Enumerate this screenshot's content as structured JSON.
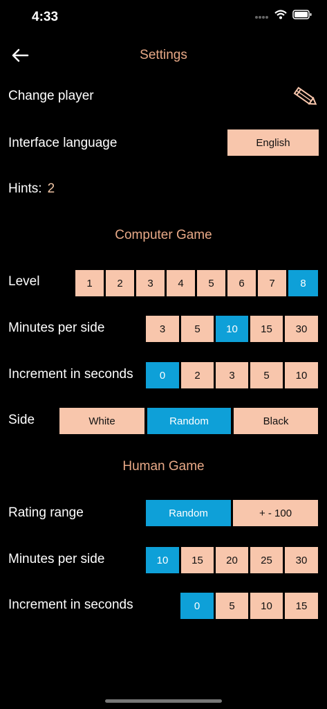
{
  "status": {
    "time": "4:33"
  },
  "header": {
    "title": "Settings"
  },
  "change_player": {
    "label": "Change player"
  },
  "language": {
    "label": "Interface language",
    "value": "English"
  },
  "hints": {
    "label": "Hints:",
    "value": "2"
  },
  "computer_game": {
    "title": "Computer Game",
    "level": {
      "label": "Level",
      "options": [
        "1",
        "2",
        "3",
        "4",
        "5",
        "6",
        "7",
        "8"
      ],
      "selected": "8"
    },
    "minutes": {
      "label": "Minutes per side",
      "options": [
        "3",
        "5",
        "10",
        "15",
        "30"
      ],
      "selected": "10"
    },
    "increment": {
      "label": "Increment in seconds",
      "options": [
        "0",
        "2",
        "3",
        "5",
        "10"
      ],
      "selected": "0"
    },
    "side": {
      "label": "Side",
      "options": [
        "White",
        "Random",
        "Black"
      ],
      "selected": "Random"
    }
  },
  "human_game": {
    "title": "Human Game",
    "rating": {
      "label": "Rating range",
      "options": [
        "Random",
        "+ - 100"
      ],
      "selected": "Random"
    },
    "minutes": {
      "label": "Minutes per side",
      "options": [
        "10",
        "15",
        "20",
        "25",
        "30"
      ],
      "selected": "10"
    },
    "increment": {
      "label": "Increment in seconds",
      "options": [
        "0",
        "5",
        "10",
        "15"
      ],
      "selected": "0"
    }
  },
  "colors": {
    "accent": "#e8a987",
    "button": "#f8c6ac",
    "selected": "#0ea0d8"
  }
}
